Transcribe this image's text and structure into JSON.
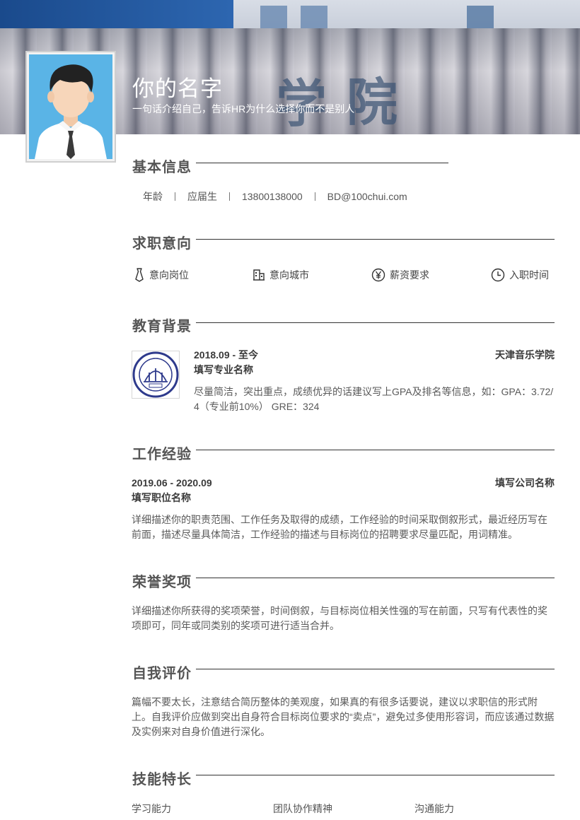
{
  "header": {
    "name": "你的名字",
    "tagline": "一句话介绍自己，告诉HR为什么选择你而不是别人",
    "banner_glyphs": [
      "学",
      "院"
    ]
  },
  "basic_info": {
    "title": "基本信息",
    "items": [
      "年龄",
      "应届生",
      "13800138000",
      "BD@100chui.com"
    ]
  },
  "job_intent": {
    "title": "求职意向",
    "items": [
      {
        "icon": "tie-icon",
        "label": "意向岗位"
      },
      {
        "icon": "building-icon",
        "label": "意向城市"
      },
      {
        "icon": "yen-icon",
        "label": "薪资要求"
      },
      {
        "icon": "clock-icon",
        "label": "入职时间"
      }
    ]
  },
  "education": {
    "title": "教育背景",
    "period": "2018.09 - 至今",
    "school": "天津音乐学院",
    "major": "填写专业名称",
    "desc": "尽量简洁，突出重点，成绩优异的话建议写上GPA及排名等信息，如：GPA：3.72/4（专业前10%） GRE：324"
  },
  "work": {
    "title": "工作经验",
    "period": "2019.06 - 2020.09",
    "company": "填写公司名称",
    "position": "填写职位名称",
    "desc": "详细描述你的职责范围、工作任务及取得的成绩，工作经验的时间采取倒叙形式，最近经历写在前面，描述尽量具体简洁，工作经验的描述与目标岗位的招聘要求尽量匹配，用词精准。"
  },
  "honors": {
    "title": "荣誉奖项",
    "desc": "详细描述你所获得的奖项荣誉，时间倒叙，与目标岗位相关性强的写在前面，只写有代表性的奖项即可，同年或同类别的奖项可进行适当合并。"
  },
  "self_eval": {
    "title": "自我评价",
    "desc": "篇幅不要太长，注意结合简历整体的美观度，如果真的有很多话要说，建议以求职信的形式附上。自我评价应做到突出自身符合目标岗位要求的“卖点”，避免过多使用形容词，而应该通过数据及实例来对自身价值进行深化。"
  },
  "skills": {
    "title": "技能特长",
    "items": [
      "学习能力",
      "团队协作精神",
      "沟通能力"
    ]
  },
  "colors": {
    "accent": "#333333",
    "text": "#5a5a5a",
    "avatar_bg": "#5ab4e6"
  }
}
